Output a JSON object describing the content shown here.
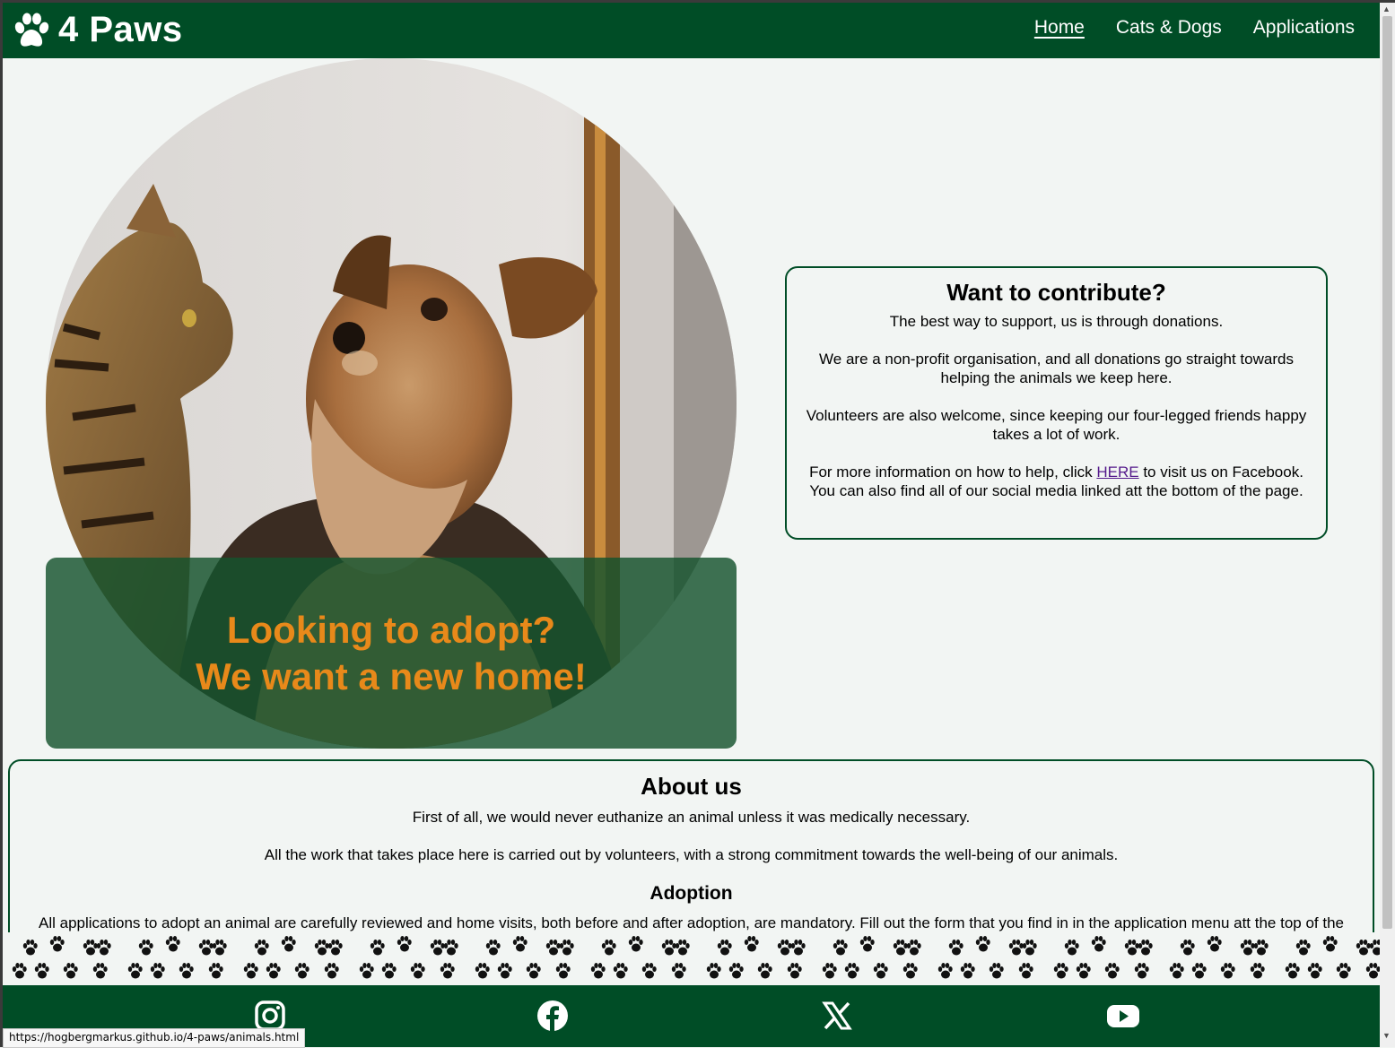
{
  "header": {
    "logo_text": "4 Paws",
    "nav": [
      {
        "label": "Home",
        "active": true
      },
      {
        "label": "Cats & Dogs",
        "active": false
      },
      {
        "label": "Applications",
        "active": false
      }
    ]
  },
  "hero": {
    "line1": "Looking to adopt?",
    "line2": "We want a new home!"
  },
  "contribute": {
    "title": "Want to contribute?",
    "p1": "The best way to support, us is through donations.",
    "p2": "We are a non-profit organisation, and all donations go straight towards helping the animals we keep here.",
    "p3": "Volunteers are also welcome, since keeping our four-legged friends happy takes a lot of work.",
    "p4_before": "For more information on how to help, click ",
    "p4_link": "HERE",
    "p4_after": " to visit us on Facebook.",
    "p4_line2": "You can also find all of our social media linked att the bottom of the page."
  },
  "about": {
    "title": "About us",
    "p1": "First of all, we would never euthanize an animal unless it was medically necessary.",
    "p2": "All the work that takes place here is carried out by volunteers, with a strong commitment towards the well-being of our animals.",
    "adoption_title": "Adoption",
    "adoption_text": "All applications to adopt an animal are carefully reviewed and home visits, both before and after adoption, are mandatory. Fill out the form that you find in in the application menu att the top of the"
  },
  "footer": {
    "social": [
      "instagram-icon",
      "facebook-icon",
      "x-icon",
      "youtube-icon"
    ]
  },
  "status_url": "https://hogbergmarkus.github.io/4-paws/animals.html",
  "colors": {
    "header_bg": "#004d26",
    "accent_orange": "#e8891a",
    "page_bg": "#f2f5f3"
  }
}
